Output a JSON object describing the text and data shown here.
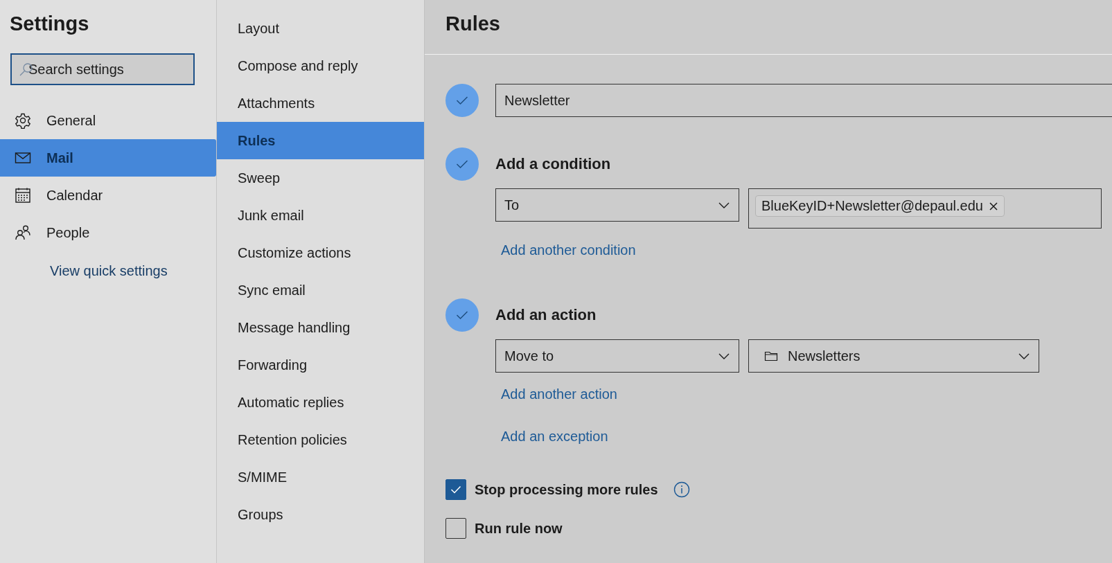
{
  "sidebar": {
    "title": "Settings",
    "search": {
      "placeholder": "Search settings"
    },
    "items": [
      {
        "label": "General",
        "selected": false
      },
      {
        "label": "Mail",
        "selected": true
      },
      {
        "label": "Calendar",
        "selected": false
      },
      {
        "label": "People",
        "selected": false
      }
    ],
    "link": "View quick settings"
  },
  "submenu": {
    "items": [
      {
        "label": "Layout",
        "selected": false
      },
      {
        "label": "Compose and reply",
        "selected": false
      },
      {
        "label": "Attachments",
        "selected": false
      },
      {
        "label": "Rules",
        "selected": true
      },
      {
        "label": "Sweep",
        "selected": false
      },
      {
        "label": "Junk email",
        "selected": false
      },
      {
        "label": "Customize actions",
        "selected": false
      },
      {
        "label": "Sync email",
        "selected": false
      },
      {
        "label": "Message handling",
        "selected": false
      },
      {
        "label": "Forwarding",
        "selected": false
      },
      {
        "label": "Automatic replies",
        "selected": false
      },
      {
        "label": "Retention policies",
        "selected": false
      },
      {
        "label": "S/MIME",
        "selected": false
      },
      {
        "label": "Groups",
        "selected": false
      }
    ]
  },
  "main": {
    "title": "Rules",
    "steps": [
      {
        "kind": "name",
        "completed": true,
        "value": "Newsletter"
      },
      {
        "kind": "condition",
        "completed": true,
        "heading": "Add a condition",
        "select": "To",
        "chips": [
          "BlueKeyID+Newsletter@depaul.edu"
        ],
        "links": [
          "Add another condition"
        ]
      },
      {
        "kind": "action",
        "completed": true,
        "heading": "Add an action",
        "select": "Move to",
        "folder": "Newsletters",
        "links": [
          "Add another action",
          "Add an exception"
        ]
      }
    ],
    "options": [
      {
        "label": "Stop processing more rules",
        "checked": true,
        "info": true
      },
      {
        "label": "Run rule now",
        "checked": false,
        "info": false
      }
    ]
  }
}
